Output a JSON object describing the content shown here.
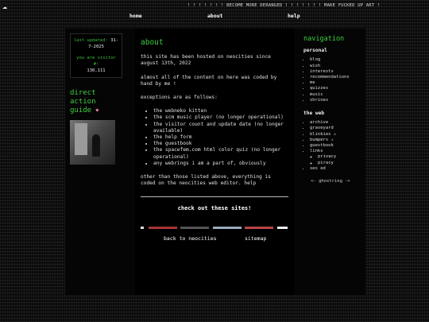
{
  "marquee": "! ! ! ! ! ! ! BECOME MORE DERANGED ! ! ! ! ! ! ! MAKE FUCKED UP ART !",
  "nav": {
    "home": "home",
    "about": "about",
    "help": "help"
  },
  "stats": {
    "updated_label": "last updated:",
    "updated_value": "31-7-2025",
    "visitor_label": "you are visitor #:",
    "visitor_value": "130,111"
  },
  "direct_action": {
    "title_1": "direct action",
    "title_2": "guide",
    "icon": "heart-icon"
  },
  "main": {
    "title": "about",
    "p1": "this site has been hosted on neocities since august 13th, 2022",
    "p2": "almost all of the content on here was coded by hand by me !",
    "p3": "exceptions are as follows:",
    "exceptions": [
      "the webneko kitten",
      "the scm music player (no longer operational)",
      "the visitor count and update date (no longer available)",
      "the help form",
      "the guestbook",
      "the spacefem.com html color quiz (no longer operational)",
      "any webrings i am a part of, obviously"
    ],
    "p4": "other than those listed above, everything is coded on the neocities web editor. help",
    "sites_heading": "check out these sites!"
  },
  "bottom": {
    "back": "back to neocities",
    "sitemap": "sitemap"
  },
  "nav_side": {
    "title": "navigation",
    "personal_heading": "personal",
    "personal": [
      "blog",
      "wish",
      "interests",
      "recommendations",
      "me",
      "quizzes",
      "music",
      "shrines"
    ],
    "web_heading": "the web",
    "web": [
      "archive",
      "graveyard",
      "blinkies ⚠",
      "bumpers ⚠",
      "guestbook",
      "links"
    ],
    "links_sub": [
      "privacy",
      "piracy"
    ],
    "web_last": "sex ed",
    "ghostring": "<- ghostring ->"
  },
  "colors": {
    "accent": "#3fcf3f",
    "bg": "#0a0a0a"
  }
}
